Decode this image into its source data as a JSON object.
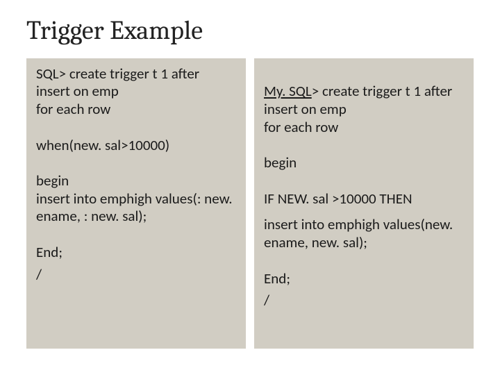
{
  "title": "Trigger Example",
  "left": {
    "b1": "SQL> create  trigger t 1 after insert on emp\nfor each row",
    "b2": "when(new. sal>10000)",
    "b3": "begin\ninsert into emphigh values(: new. ename, : new. sal);",
    "b4a": "End;",
    "b4b": "/"
  },
  "right": {
    "b1a": "My. SQL",
    "b1b": "> create  trigger t 1 after insert on emp\nfor each row",
    "b2": "begin",
    "b3": "IF NEW. sal >10000 THEN",
    "b4": "insert into emphigh values(new. ename, new. sal);",
    "b5a": "End;",
    "b5b": "/"
  }
}
